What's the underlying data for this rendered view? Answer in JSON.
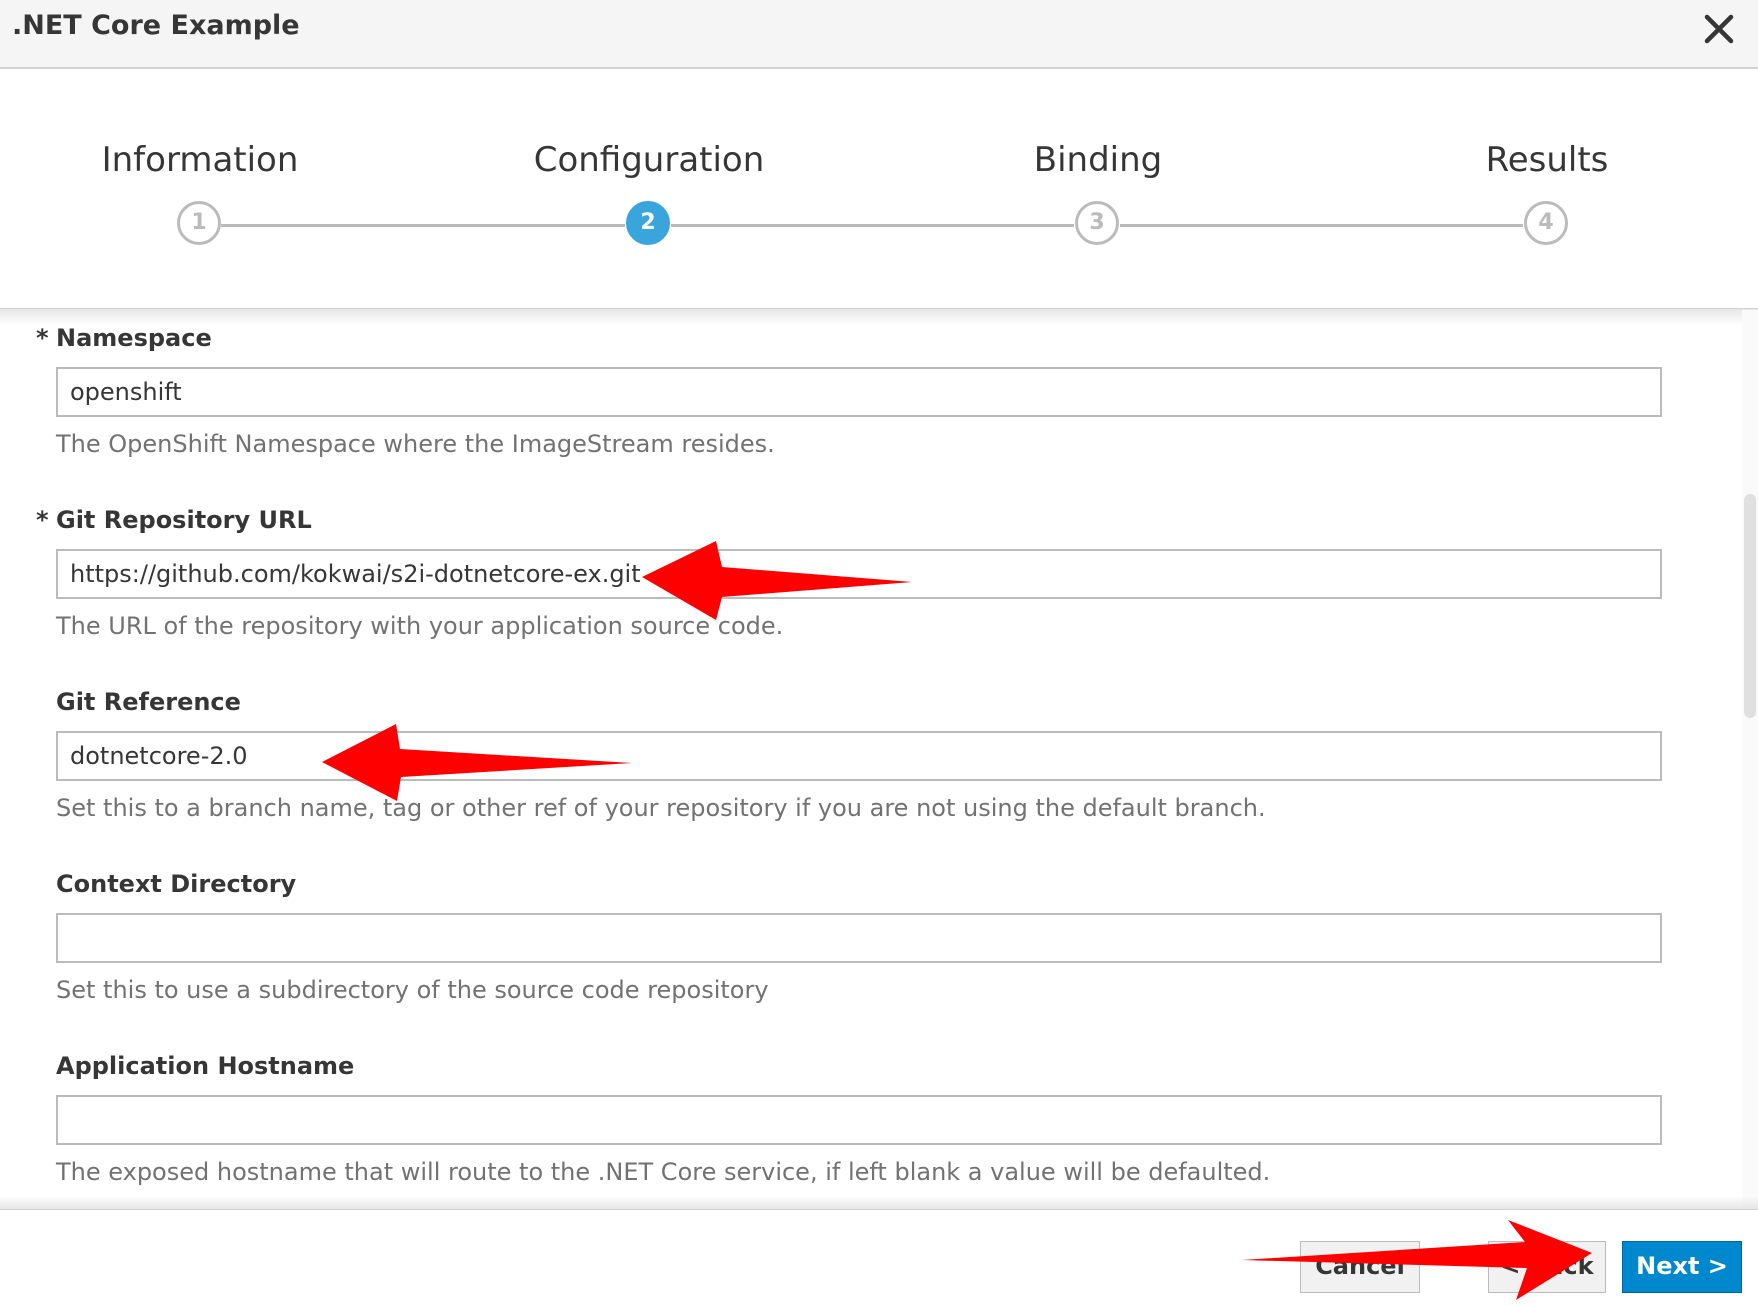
{
  "dialog": {
    "title": ".NET Core Example",
    "close_icon": "close-icon"
  },
  "wizard": {
    "steps": [
      {
        "label": "Information",
        "number": "1",
        "active": false
      },
      {
        "label": "Configuration",
        "number": "2",
        "active": true
      },
      {
        "label": "Binding",
        "number": "3",
        "active": false
      },
      {
        "label": "Results",
        "number": "4",
        "active": false
      }
    ],
    "accent_color": "#39a5dc"
  },
  "form": {
    "namespace": {
      "required_mark": "*",
      "label": "Namespace",
      "value": "openshift",
      "help": "The OpenShift Namespace where the ImageStream resides."
    },
    "git_repository_url": {
      "required_mark": "*",
      "label": "Git Repository URL",
      "value": "https://github.com/kokwai/s2i-dotnetcore-ex.git",
      "help": "The URL of the repository with your application source code."
    },
    "git_reference": {
      "label": "Git Reference",
      "value": "dotnetcore-2.0",
      "help": "Set this to a branch name, tag or other ref of your repository if you are not using the default branch."
    },
    "context_directory": {
      "label": "Context Directory",
      "value": "",
      "help": "Set this to use a subdirectory of the source code repository"
    },
    "application_hostname": {
      "label": "Application Hostname",
      "value": "",
      "help": "The exposed hostname that will route to the .NET Core service, if left blank a value will be defaulted."
    }
  },
  "footer": {
    "cancel_label": "Cancel",
    "back_label": "< Back",
    "next_label": "Next >",
    "primary_color": "#0088ce"
  },
  "annotations": {
    "arrow_color": "#ff0000",
    "arrow_icon": "red-arrow-icon"
  }
}
